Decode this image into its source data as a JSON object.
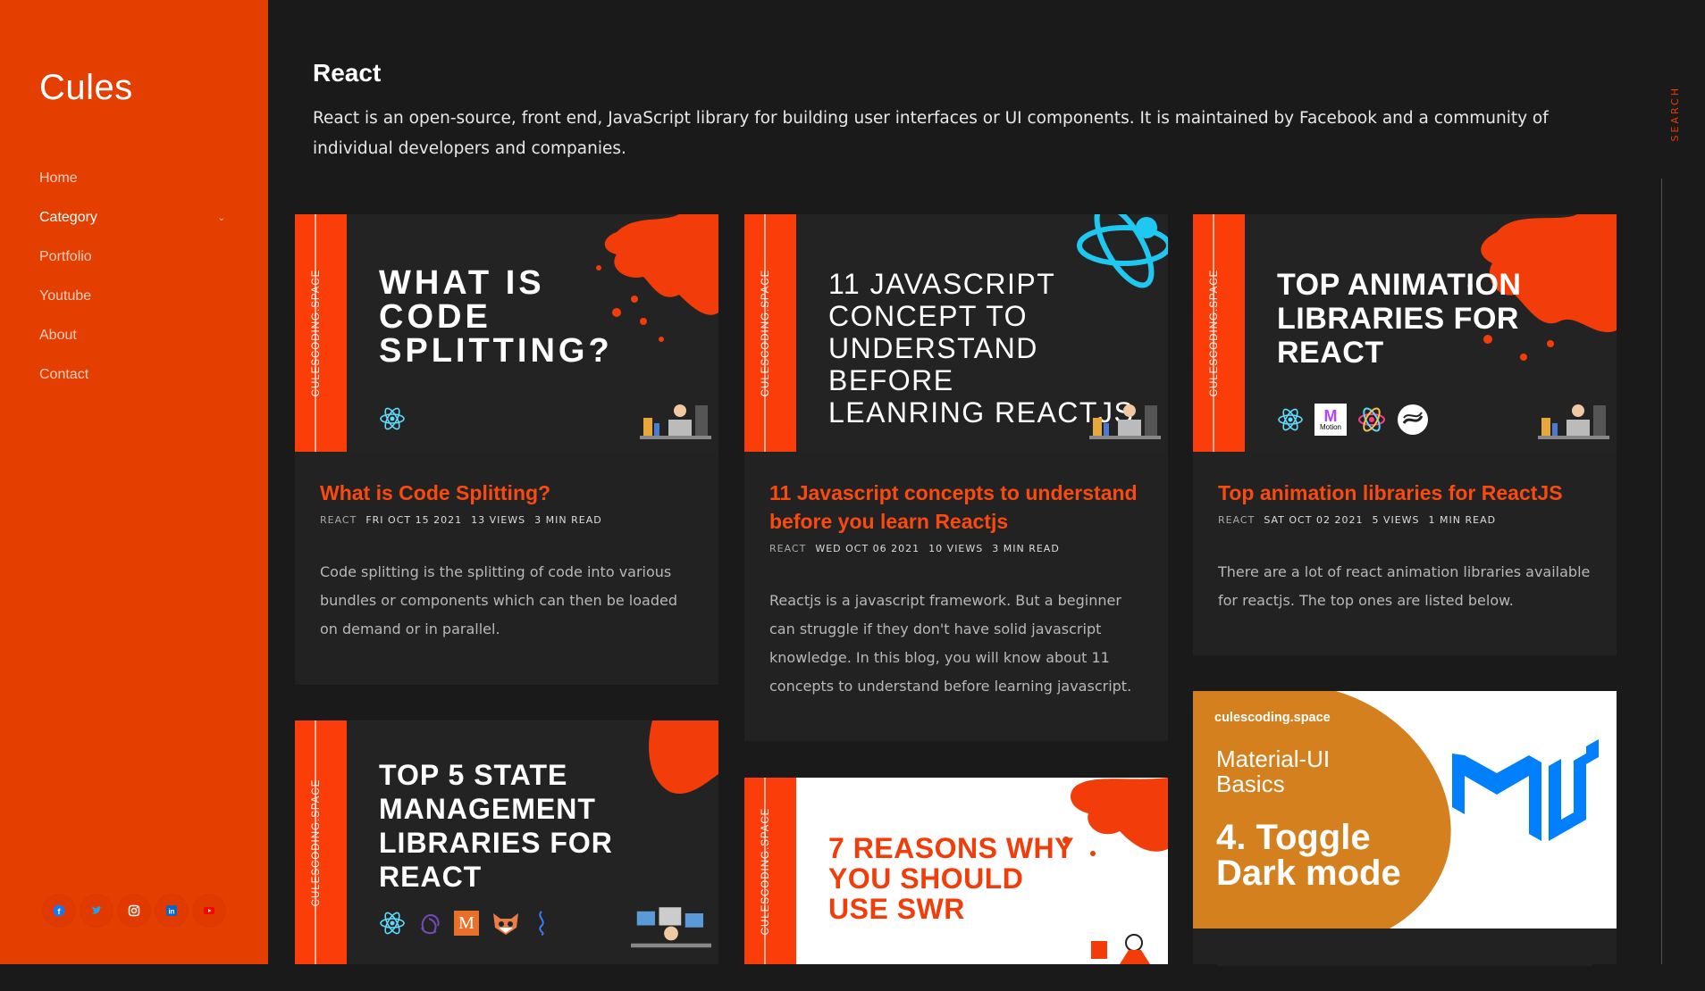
{
  "sidebar": {
    "logo": "Cules",
    "nav": [
      {
        "label": "Home"
      },
      {
        "label": "Category"
      },
      {
        "label": "Portfolio"
      },
      {
        "label": "Youtube"
      },
      {
        "label": "About"
      },
      {
        "label": "Contact"
      }
    ],
    "socials": [
      "facebook-icon",
      "twitter-icon",
      "instagram-icon",
      "linkedin-icon",
      "youtube-icon"
    ]
  },
  "page": {
    "title": "React",
    "description": "React is an open-source, front end, JavaScript library for building user interfaces or UI components. It is maintained by Facebook and a community of individual developers and companies."
  },
  "search": {
    "label": "SEARCH"
  },
  "brand_text": "CULESCODING.SPACE",
  "cards": [
    {
      "banner": "WHAT IS\nCODE\nSPLITTING?",
      "title": "What is Code Splitting?",
      "category": "REACT",
      "date": "FRI OCT 15 2021",
      "views": "13 VIEWS",
      "read": "3 MIN READ",
      "excerpt": "Code splitting is the splitting of code into various bundles or components which can then be loaded on demand or in parallel."
    },
    {
      "banner": "11 JAVASCRIPT\nCONCEPT TO\nUNDERSTAND BEFORE\nLEANRING REACTJS",
      "title": "11 Javascript concepts to understand before you learn Reactjs",
      "category": "REACT",
      "date": "WED OCT 06 2021",
      "views": "10 VIEWS",
      "read": "3 MIN READ",
      "excerpt": "Reactjs is a javascript framework. But a beginner can struggle if they don't have solid javascript knowledge. In this blog, you will know about 11 concepts to understand before learning javascript."
    },
    {
      "banner": "TOP ANIMATION\nLIBRARIES FOR\nREACT",
      "title": "Top animation libraries for ReactJS",
      "category": "REACT",
      "date": "SAT OCT 02 2021",
      "views": "5 VIEWS",
      "read": "1 MIN READ",
      "excerpt": "There are a lot of react animation libraries available for reactjs. The top ones are listed below.",
      "motion_label": "Motion"
    },
    {
      "banner": "TOP 5 STATE\nMANAGEMENT\nLIBRARIES FOR\nREACT"
    },
    {
      "banner": "7 REASONS WHY\nYOU SHOULD\nUSE SWR"
    },
    {
      "brand": "culescoding.space",
      "subtitle": "Material-UI\nBasics",
      "banner": "4. Toggle\nDark mode"
    }
  ],
  "colors": {
    "accent": "#e43f00",
    "stripe": "#fb3d0a",
    "title": "#fb4a10",
    "bg": "#1a1a1a",
    "card": "#222222"
  }
}
